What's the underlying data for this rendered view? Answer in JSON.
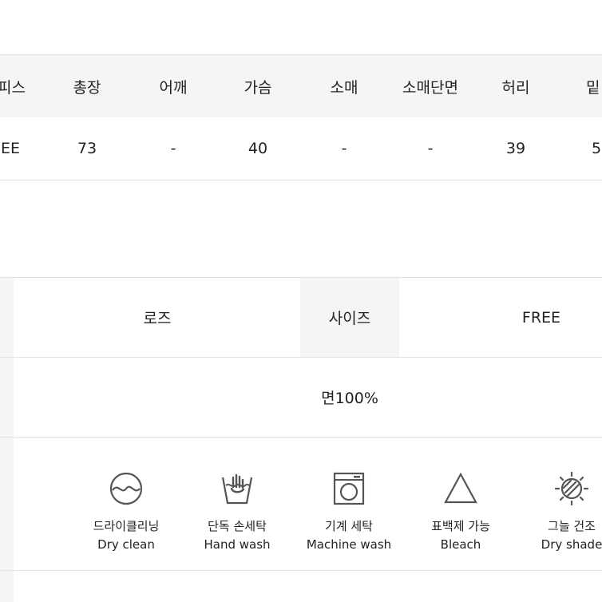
{
  "size_table": {
    "headers": [
      "피스",
      "총장",
      "어깨",
      "가슴",
      "소매",
      "소매단면",
      "허리",
      "밑"
    ],
    "values": [
      "EE",
      "73",
      "-",
      "40",
      "-",
      "-",
      "39",
      "5"
    ]
  },
  "info_table": {
    "fit_value": "로즈",
    "size_label": "사이즈",
    "size_value": "FREE",
    "material": "면100%"
  },
  "care": [
    {
      "icon": "dry-clean-icon",
      "ko": "드라이클리닝",
      "en": "Dry clean"
    },
    {
      "icon": "hand-wash-icon",
      "ko": "단독 손세탁",
      "en": "Hand wash"
    },
    {
      "icon": "machine-wash-icon",
      "ko": "기계 세탁",
      "en": "Machine wash"
    },
    {
      "icon": "bleach-icon",
      "ko": "표백제 가능",
      "en": "Bleach"
    },
    {
      "icon": "dry-shade-icon",
      "ko": "그늘 건조",
      "en": "Dry shade"
    }
  ],
  "colors": {
    "header_bg": "#f5f5f5",
    "border": "#e2e2e2",
    "icon": "#555555",
    "text": "#222222"
  }
}
